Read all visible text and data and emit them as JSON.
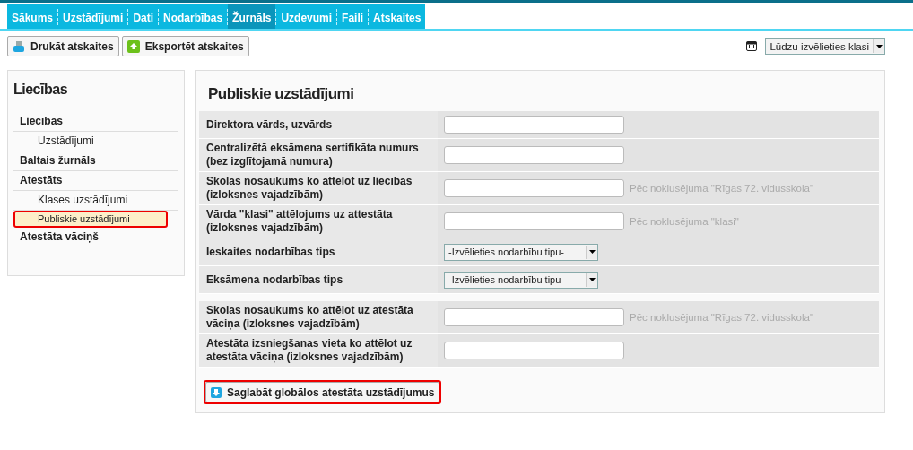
{
  "nav": [
    {
      "label": "Sākums",
      "selected": false
    },
    {
      "label": "Uzstādījumi",
      "selected": false
    },
    {
      "label": "Dati",
      "selected": false
    },
    {
      "label": "Nodarbības",
      "selected": false
    },
    {
      "label": "Žurnāls",
      "selected": true
    },
    {
      "label": "Uzdevumi",
      "selected": false
    },
    {
      "label": "Faili",
      "selected": false
    },
    {
      "label": "Atskaites",
      "selected": false
    }
  ],
  "toolbar": {
    "buttons": [
      {
        "kind": "print",
        "label": "Drukāt atskaites"
      },
      {
        "kind": "export",
        "label": "Eksportēt atskaites"
      }
    ],
    "class_select": {
      "value": "Lūdzu izvēlieties klasi"
    }
  },
  "sidebar": {
    "title": "Liecības",
    "items": [
      {
        "label": "Liecības",
        "selected": false,
        "children": [
          {
            "label": "Uzstādījumi",
            "selected": false
          }
        ]
      },
      {
        "label": "Baltais žurnāls",
        "selected": false
      },
      {
        "label": "Atestāts",
        "selected": false,
        "children": [
          {
            "label": "Klases uzstādījumi",
            "selected": false
          },
          {
            "label": "Publiskie uzstādījumi",
            "selected": true
          }
        ]
      },
      {
        "label": "Atestāta vāciņš",
        "selected": false
      }
    ]
  },
  "main": {
    "title": "Publiskie uzstādījumi",
    "groups": [
      [
        {
          "label": "Direktora vārds, uzvārds",
          "kind": "text"
        },
        {
          "label": "Centralizētā eksāmena sertifikāta numurs (bez izglītojamā numura)",
          "kind": "text"
        },
        {
          "label": "Skolas nosaukums ko attēlot uz liecības (izloksnes vajadzībām)",
          "kind": "text",
          "hint": "Pēc noklusējuma \"Rīgas 72. vidusskola\""
        },
        {
          "label": "Vārda \"klasi\" attēlojums uz attestāta (izloksnes vajadzībām)",
          "kind": "text",
          "hint": "Pēc noklusējuma \"klasi\""
        },
        {
          "label": "Ieskaites nodarbības tips",
          "kind": "select",
          "value": "-Izvēlieties nodarbību tipu-"
        },
        {
          "label": "Eksāmena nodarbības tips",
          "kind": "select",
          "value": "-Izvēlieties nodarbību tipu-"
        }
      ],
      [
        {
          "label": "Skolas nosaukums ko attēlot uz atestāta vāciņa (izloksnes vajadzībām)",
          "kind": "text",
          "hint": "Pēc noklusējuma \"Rīgas 72. vidusskola\""
        },
        {
          "label": "Atestāta izsniegšanas vieta ko attēlot uz atestāta vāciņa (izloksnes vajadzībām)",
          "kind": "text"
        }
      ]
    ],
    "save_button": {
      "label": "Saglabāt globālos atestāta uzstādījumus",
      "highlighted": true
    }
  }
}
